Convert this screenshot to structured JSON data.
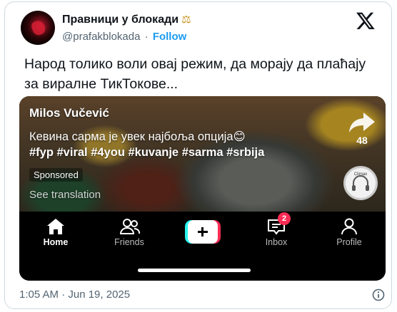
{
  "tweet": {
    "display_name": "Правници у блокади",
    "handle": "@prafakblokada",
    "separator": "·",
    "follow_label": "Follow",
    "text": "Народ толико воли овај режим, да морају да плаћају за виралне ТикТокове...",
    "timestamp": "1:05 AM · Jun 19, 2025"
  },
  "media": {
    "author": "Milos Vučević",
    "caption": "Кевина сарма је увек најбоља опција😊",
    "hashtags": "#fyp #viral #4you #kuvanje #sarma #srbija",
    "sponsored": "Sponsored",
    "see_translation": "See translation",
    "share_count": "48",
    "disc_text": "Climax"
  },
  "nav": {
    "home": "Home",
    "friends": "Friends",
    "inbox": "Inbox",
    "inbox_badge": "2",
    "profile": "Profile"
  }
}
